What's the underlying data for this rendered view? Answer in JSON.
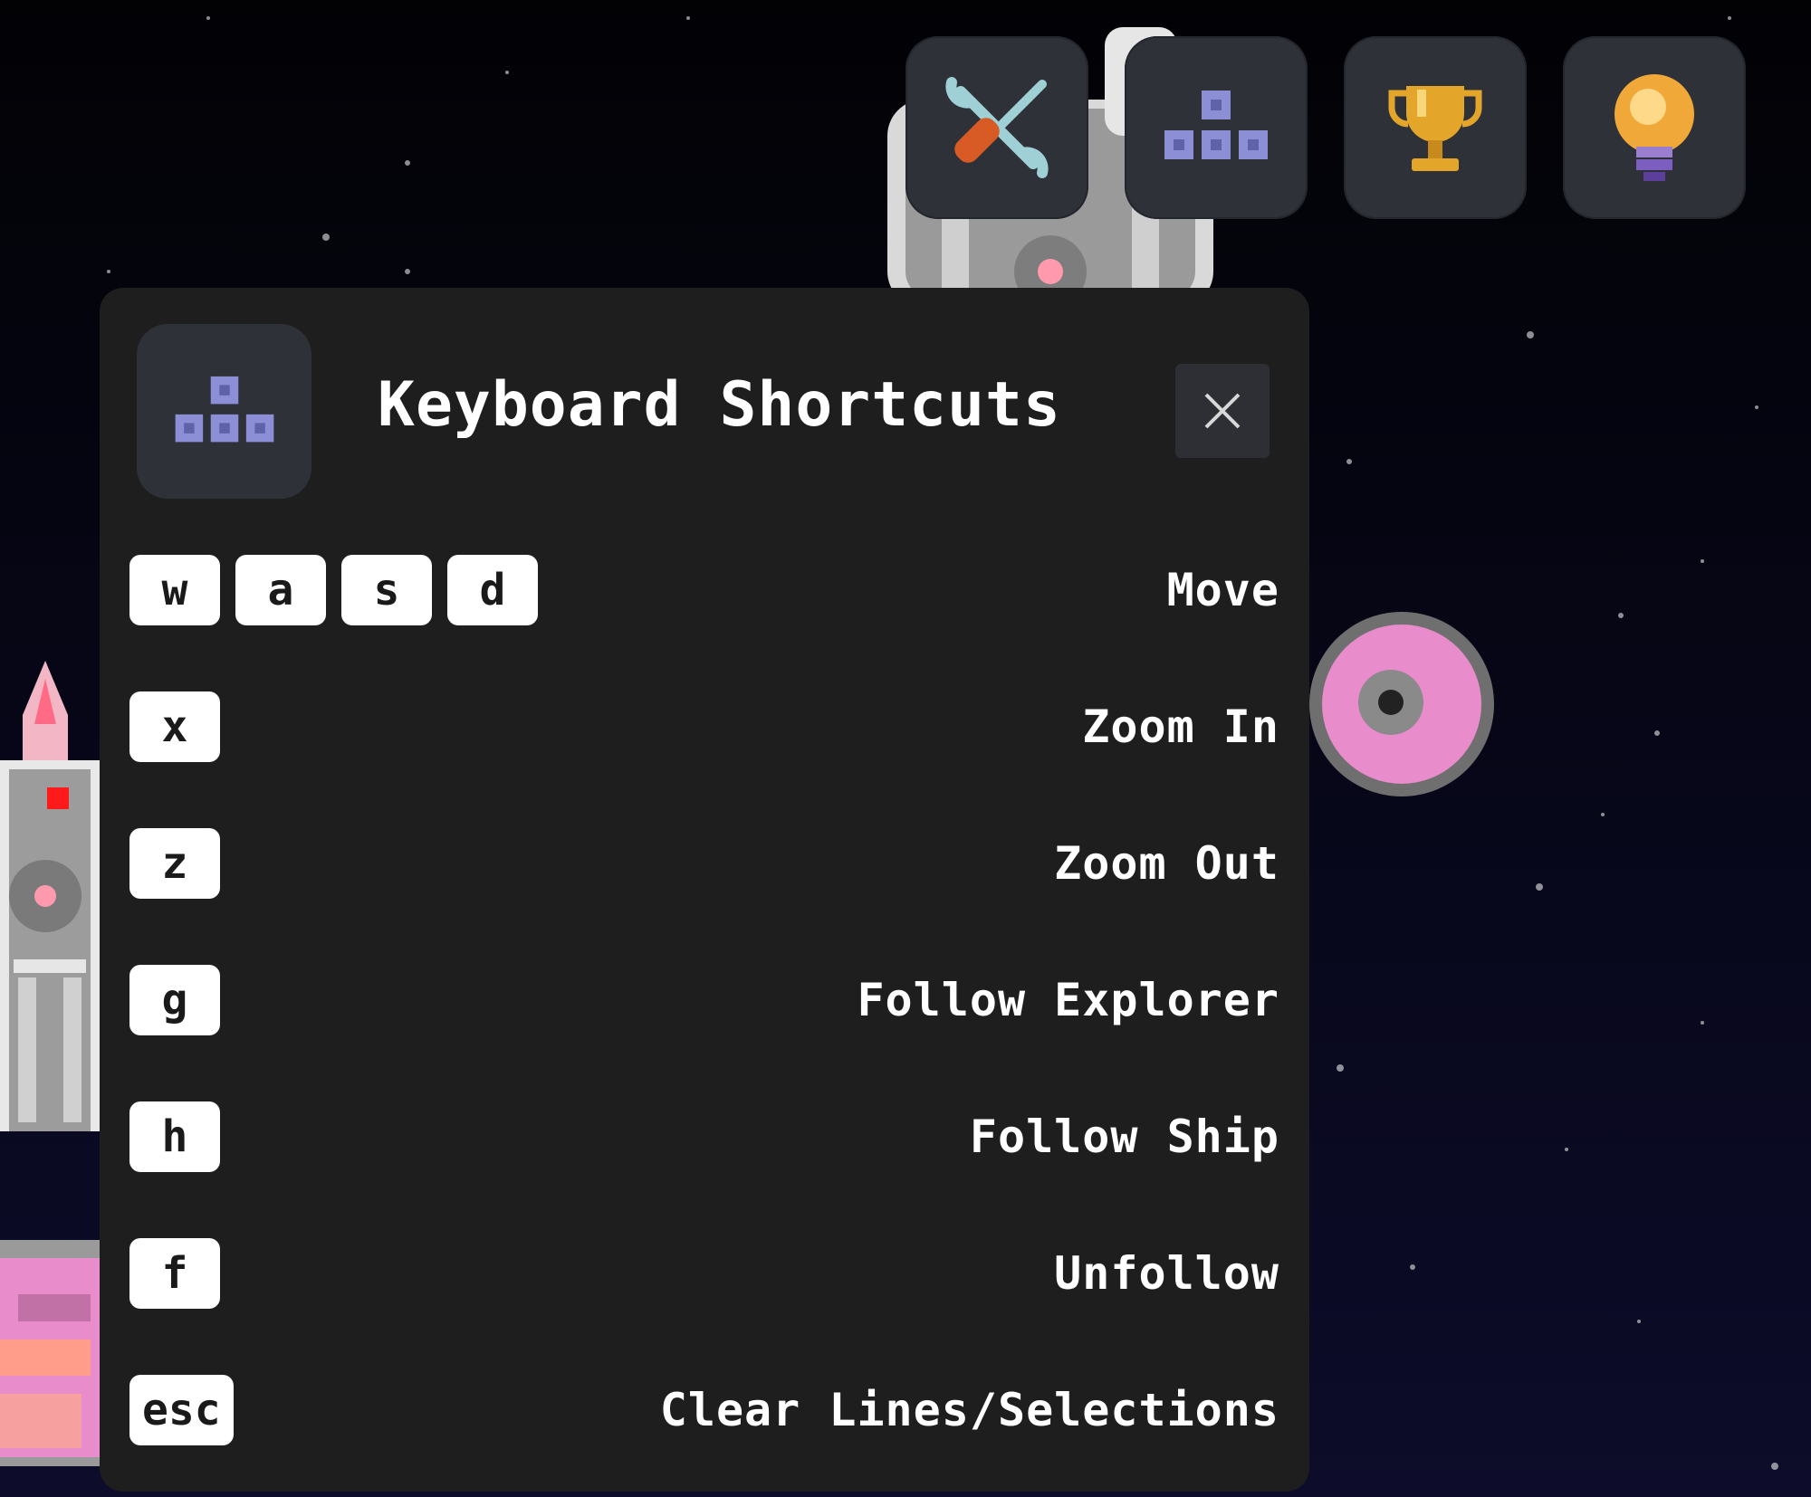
{
  "toolbar": {
    "items": [
      {
        "name": "tools",
        "icon": "tools-icon"
      },
      {
        "name": "keyboard-shortcuts",
        "icon": "keyboard-keys-icon"
      },
      {
        "name": "achievements",
        "icon": "trophy-icon"
      },
      {
        "name": "hints",
        "icon": "lightbulb-icon"
      }
    ]
  },
  "panel": {
    "title": "Keyboard Shortcuts",
    "icon": "keyboard-keys-icon",
    "close_icon": "close-icon",
    "shortcuts": [
      {
        "keys": [
          "w",
          "a",
          "s",
          "d"
        ],
        "action": "Move"
      },
      {
        "keys": [
          "x"
        ],
        "action": "Zoom In"
      },
      {
        "keys": [
          "z"
        ],
        "action": "Zoom Out"
      },
      {
        "keys": [
          "g"
        ],
        "action": "Follow Explorer"
      },
      {
        "keys": [
          "h"
        ],
        "action": "Follow Ship"
      },
      {
        "keys": [
          "f"
        ],
        "action": "Unfollow"
      },
      {
        "keys": [
          "esc"
        ],
        "action": "Clear Lines/Selections"
      }
    ]
  },
  "colors": {
    "panel_bg": "#1e1e1e",
    "button_bg": "#2e3138",
    "key_bg": "#ffffff",
    "text": "#ffffff",
    "space_bg": "#05050c",
    "planet_pink": "#e98ccc"
  }
}
